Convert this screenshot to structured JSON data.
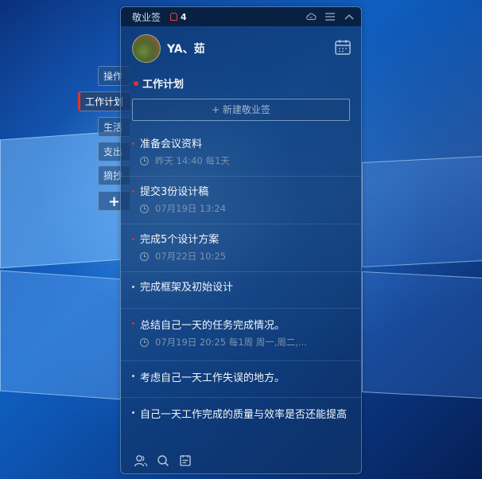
{
  "app": {
    "title": "敬业签",
    "notification_count": "4"
  },
  "profile": {
    "username": "YA、茹"
  },
  "side_tabs": [
    {
      "label": "操作"
    },
    {
      "label": "工作计划"
    },
    {
      "label": "生活"
    },
    {
      "label": "支出"
    },
    {
      "label": "摘抄"
    },
    {
      "label": "+"
    }
  ],
  "section": {
    "title": "工作计划",
    "new_button": "+ 新建敬业签"
  },
  "notes": [
    {
      "title": "准备会议资料",
      "meta": "昨天 14:40 每1天"
    },
    {
      "title": "提交3份设计稿",
      "meta": "07月19日 13:24"
    },
    {
      "title": "完成5个设计方案",
      "meta": "07月22日 10:25"
    },
    {
      "title": "完成框架及初始设计",
      "meta": ""
    },
    {
      "title": "总结自己一天的任务完成情况。",
      "meta": "07月19日 20:25 每1周 周一,周二,..."
    },
    {
      "title": "考虑自己一天工作失误的地方。",
      "meta": ""
    },
    {
      "title": "自己一天工作完成的质量与效率是否还能提高",
      "meta": ""
    }
  ],
  "icons": {
    "notification": "bell-icon",
    "cloud": "cloud-icon",
    "menu": "menu-icon",
    "collapse": "chevron-up-icon",
    "calendar": "calendar-icon",
    "clock": "clock-icon",
    "contacts": "contacts-icon",
    "search": "search-icon",
    "notes": "notes-icon"
  },
  "colors": {
    "accent_red": "#e0332c",
    "panel_bg": "#103464",
    "text_primary": "#f3f6f9",
    "text_meta": "#7b93ac"
  }
}
